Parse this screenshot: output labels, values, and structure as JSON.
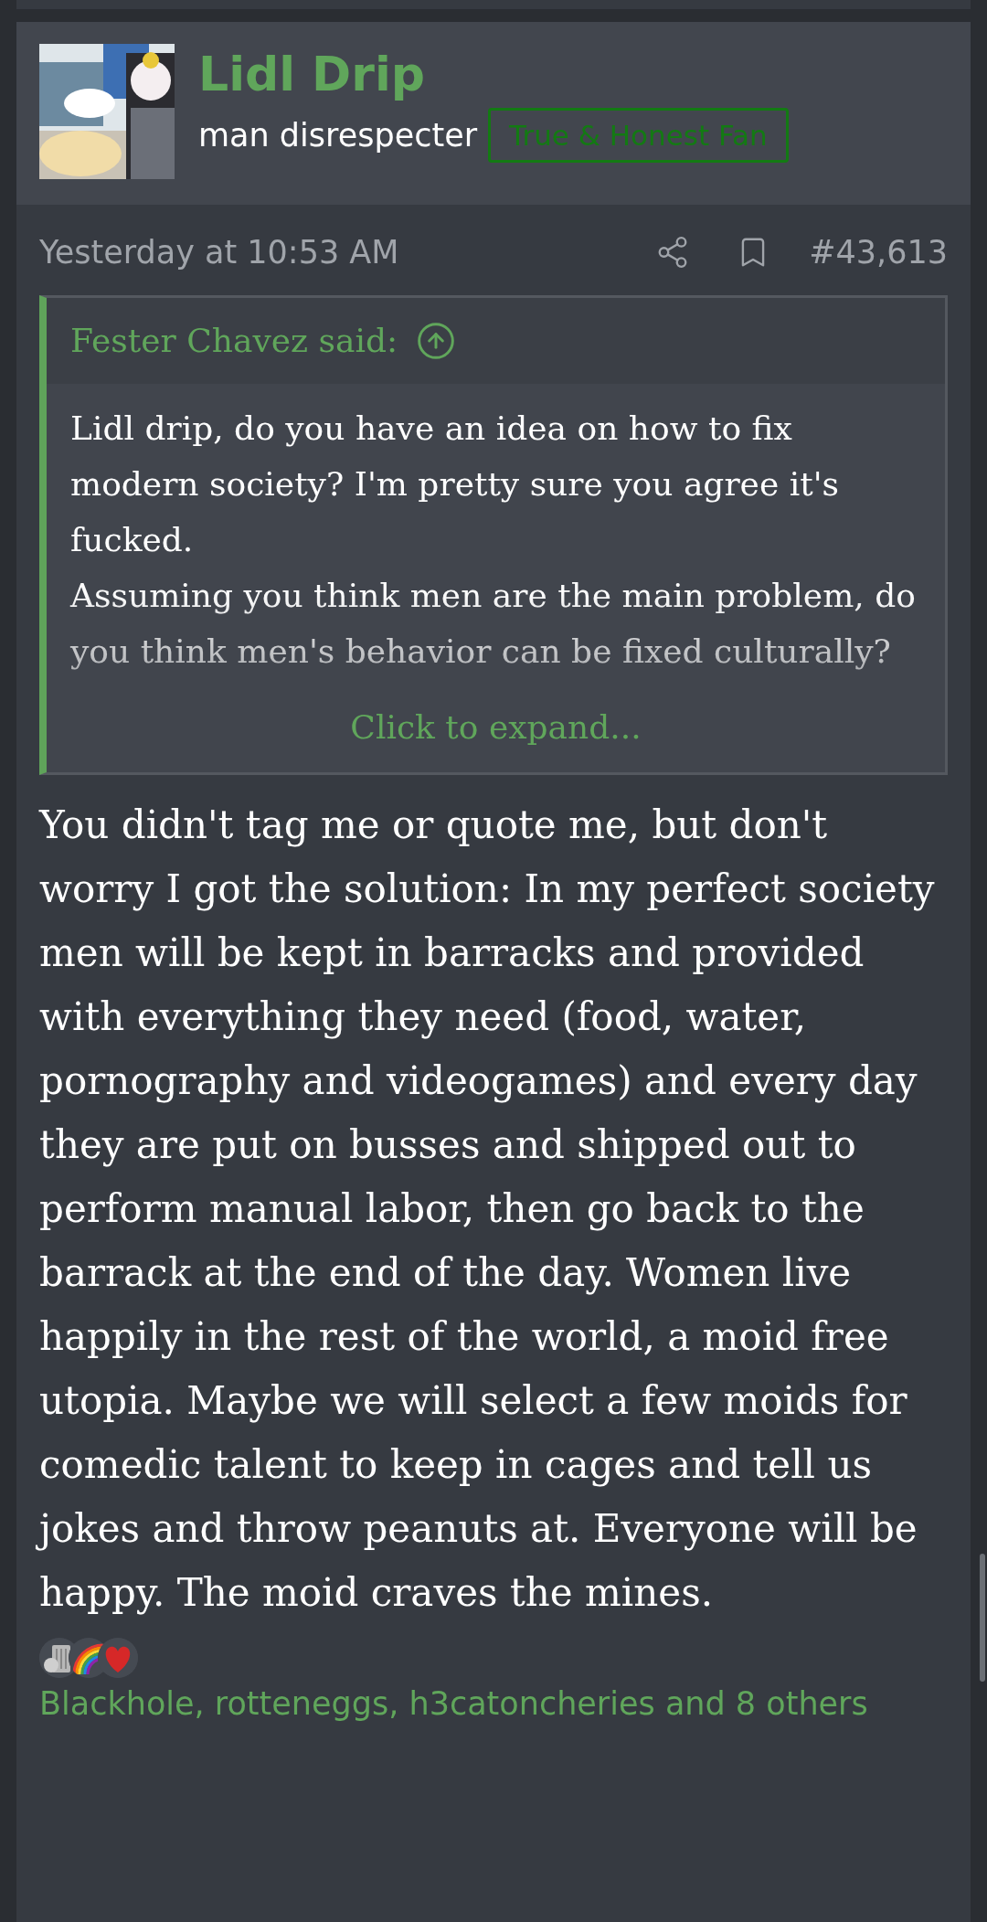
{
  "post": {
    "author": {
      "name": "Lidl Drip",
      "user_title": "man disrespecter",
      "banner": "True & Honest Fan"
    },
    "date": "Yesterday at 10:53 AM",
    "number": "#43,613",
    "quote": {
      "attribution": "Fester Chavez said:",
      "paragraphs": [
        "Lidl drip, do you have an idea on how to fix modern society? I'm pretty sure you agree it's fucked.",
        "Assuming you think men are the main problem, do you think men's behavior can be fixed culturally?"
      ],
      "expand_link": "Click to expand..."
    },
    "body": "You didn't tag me or quote me, but don't worry I got the solution: In my perfect society men will be kept in barracks and provided with everything they need (food, water, pornography and videogames) and every day they are put on busses and shipped out to perform manual labor, then go back to the barrack at the end of the day. Women live happily in the rest of the world, a moid free utopia. Maybe we will select a few moids for comedic talent to keep in cages and tell us jokes and throw peanuts at. Everyone will be happy. The moid craves the mines.",
    "reactions": {
      "icons": [
        {
          "kind": "column"
        },
        {
          "kind": "rainbow"
        },
        {
          "kind": "heart"
        }
      ],
      "summary": "Blackhole, rotteneggs, h3catoncheries and 8 others"
    }
  }
}
